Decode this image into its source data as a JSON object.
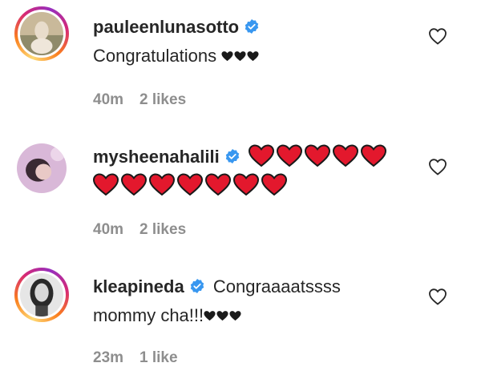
{
  "comments": [
    {
      "username": "pauleenlunasotto",
      "text": "Congratulations",
      "black_hearts": 3,
      "red_hearts": 0,
      "time": "40m",
      "likes": "2 likes"
    },
    {
      "username": "mysheenahalili",
      "text": "",
      "black_hearts": 0,
      "red_hearts": 12,
      "time": "40m",
      "likes": "2 likes"
    },
    {
      "username": "kleapineda",
      "text_line1": "Congraaaatssss",
      "text_line2": "mommy cha!!!",
      "black_hearts": 3,
      "red_hearts": 0,
      "time": "23m",
      "likes": "1 like"
    }
  ],
  "icons": {
    "verified": "verified-badge-icon",
    "like": "heart-outline-icon",
    "red_heart": "red-heart-emoji",
    "black_heart": "black-heart-emoji"
  },
  "colors": {
    "verified_blue": "#3897f0",
    "heart_red": "#e3182d",
    "meta_gray": "#8e8e8e",
    "text": "#262626"
  }
}
